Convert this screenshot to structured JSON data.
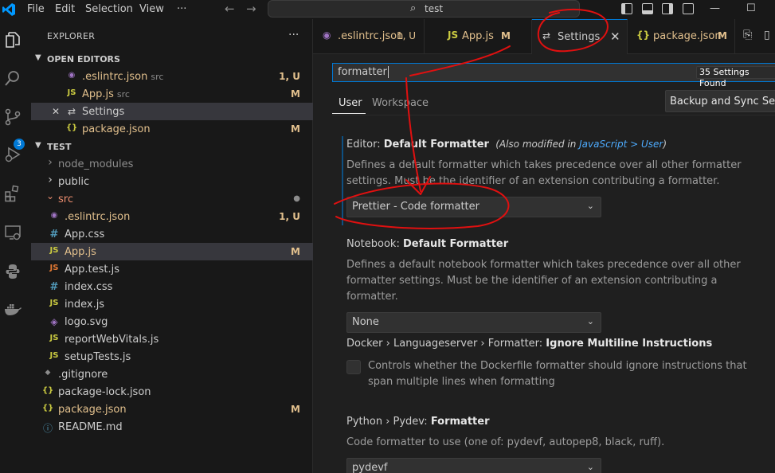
{
  "titlebar": {
    "menu": [
      "File",
      "Edit",
      "Selection",
      "View",
      "···"
    ],
    "back_arrow": "←",
    "forward_arrow": "→",
    "search_text": "test",
    "minimize": "—",
    "maximize": "☐"
  },
  "activity": {
    "badge": "3",
    "icons": [
      "explorer-icon",
      "search-icon",
      "source-control-icon",
      "run-debug-icon",
      "extensions-icon",
      "remote-explorer-icon",
      "python-icon",
      "docker-icon"
    ]
  },
  "sidebar": {
    "title": "EXPLORER",
    "more": "···",
    "open_editors_header": "OPEN EDITORS",
    "open_editors": [
      {
        "name": ".eslintrc.json",
        "desc": "src",
        "status": "1, U",
        "icon": "◉"
      },
      {
        "name": "App.js",
        "desc": "src",
        "status": "M",
        "icon": "JS"
      },
      {
        "name": "Settings",
        "desc": "",
        "status": "",
        "icon": "⇄",
        "close": "✕"
      },
      {
        "name": "package.json",
        "desc": "",
        "status": "M",
        "icon": "{}"
      }
    ],
    "workspace_header": "TEST",
    "tree": [
      {
        "name": "node_modules",
        "chev": "›",
        "icon": ""
      },
      {
        "name": "public",
        "chev": "›",
        "icon": ""
      },
      {
        "name": "src",
        "chev": "⌄",
        "icon": "",
        "status": "●"
      },
      {
        "name": ".eslintrc.json",
        "icon": "◉",
        "status": "1, U"
      },
      {
        "name": "App.css",
        "icon": "#"
      },
      {
        "name": "App.js",
        "icon": "JS",
        "status": "M"
      },
      {
        "name": "App.test.js",
        "icon": "JS"
      },
      {
        "name": "index.css",
        "icon": "#"
      },
      {
        "name": "index.js",
        "icon": "JS"
      },
      {
        "name": "logo.svg",
        "icon": "◈"
      },
      {
        "name": "reportWebVitals.js",
        "icon": "JS"
      },
      {
        "name": "setupTests.js",
        "icon": "JS"
      },
      {
        "name": ".gitignore",
        "icon": "◆"
      },
      {
        "name": "package-lock.json",
        "icon": "{}"
      },
      {
        "name": "package.json",
        "icon": "{}",
        "status": "M"
      },
      {
        "name": "README.md",
        "icon": "ⓘ"
      }
    ]
  },
  "tabs": [
    {
      "icon": "◉",
      "label": ".eslintrc.json",
      "badge": "1, U"
    },
    {
      "icon": "JS",
      "label": "App.js",
      "badge": "M"
    },
    {
      "icon": "⇄",
      "label": "Settings",
      "close": "✕"
    },
    {
      "icon": "{}",
      "label": "package.json",
      "badge": "M"
    }
  ],
  "settings": {
    "search_value": "formatter",
    "found": "35 Settings Found",
    "filter": "☰",
    "scope_tabs": [
      "User",
      "Workspace"
    ],
    "sync_button": "Backup and Sync Settings",
    "items": [
      {
        "prefix": "Editor: ",
        "name": "Default Formatter",
        "modified_prefix": "(Also modified in ",
        "modified_link": "JavaScript > User",
        "modified_suffix": ")",
        "description": "Defines a default formatter which takes precedence over all other formatter settings. Must be the identifier of an extension contributing a formatter.",
        "value": "Prettier - Code formatter"
      },
      {
        "prefix": "Notebook: ",
        "name": "Default Formatter",
        "description": "Defines a default notebook formatter which takes precedence over all other formatter settings. Must be the identifier of an extension contributing a formatter.",
        "value": "None"
      },
      {
        "prefix": "Docker › Languageserver › Formatter: ",
        "name": "Ignore Multiline Instructions",
        "description": "Controls whether the Dockerfile formatter should ignore instructions that span multiple lines when formatting"
      },
      {
        "prefix": "Python › Pydev: ",
        "name": "Formatter",
        "description": "Code formatter to use (one of: pydevf, autopep8, black, ruff).",
        "value": "pydevf"
      }
    ]
  },
  "annotation_color": "#e01010"
}
